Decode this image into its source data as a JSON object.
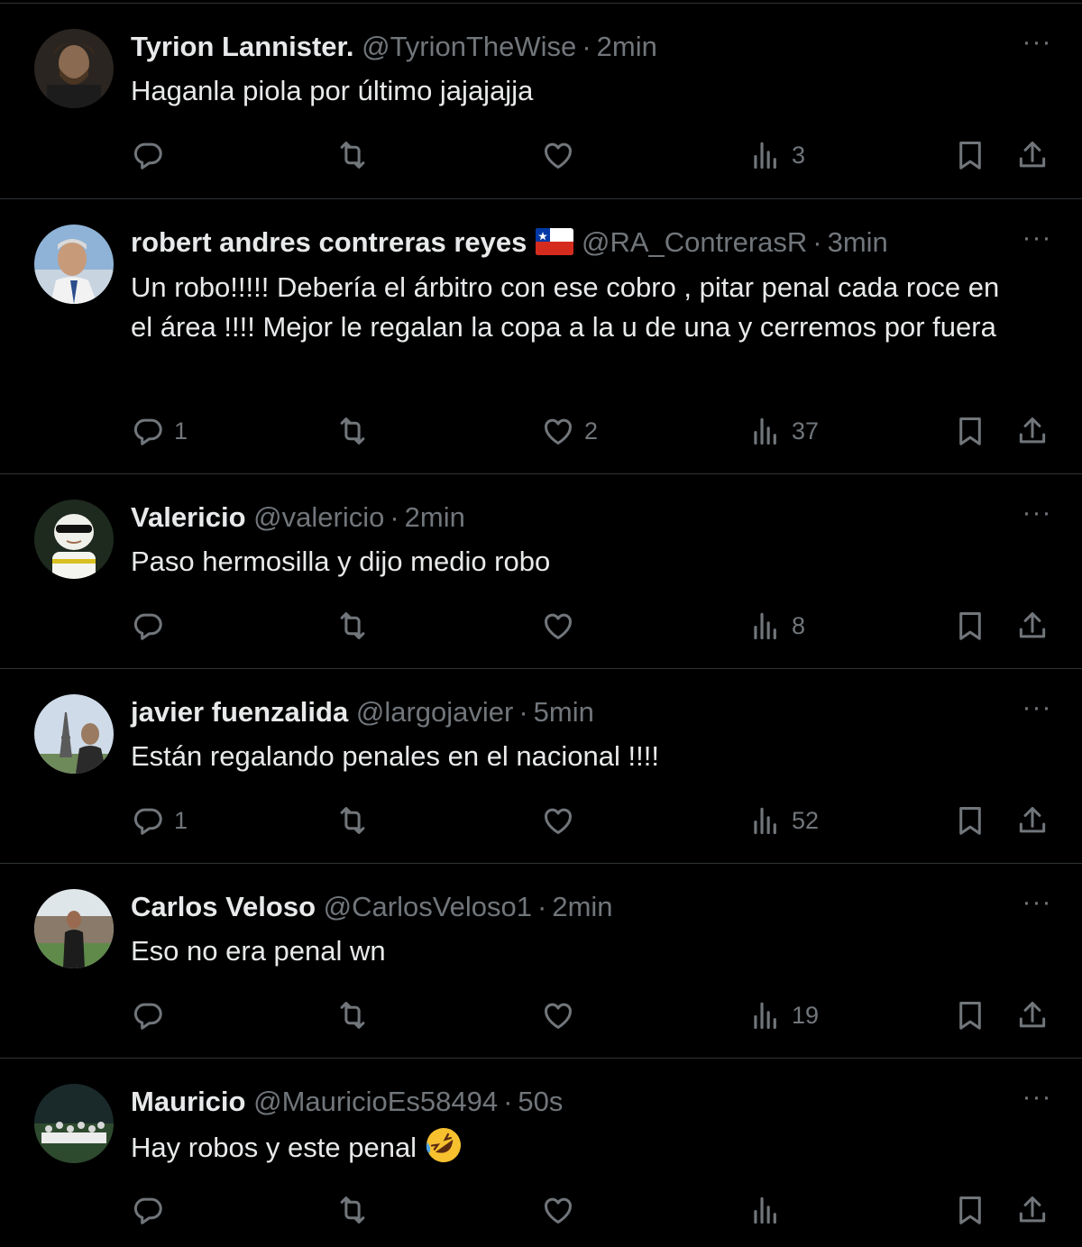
{
  "posts": [
    {
      "name": "Tyrion Lannister.",
      "handle": "@TyrionTheWise",
      "separator": "·",
      "time": "2min",
      "text": "Haganla piola por último jajajajja",
      "replies": "",
      "retweets": "",
      "likes": "",
      "views": "3"
    },
    {
      "name": "robert andres contreras reyes",
      "handle": "@RA_ContrerasR",
      "separator": "·",
      "time": "3min",
      "text": "Un robo!!!!! Debería el árbitro con ese cobro , pitar penal cada roce en el área !!!! Mejor le regalan la copa a la u de una y cerremos por fuera",
      "replies": "1",
      "retweets": "",
      "likes": "2",
      "views": "37"
    },
    {
      "name": "Valericio",
      "handle": "@valericio",
      "separator": "·",
      "time": "2min",
      "text": "Paso hermosilla y dijo medio robo",
      "replies": "",
      "retweets": "",
      "likes": "",
      "views": "8"
    },
    {
      "name": "javier fuenzalida",
      "handle": "@largojavier",
      "separator": "·",
      "time": "5min",
      "text": "Están regalando penales en el nacional !!!!",
      "replies": "1",
      "retweets": "",
      "likes": "",
      "views": "52"
    },
    {
      "name": "Carlos Veloso",
      "handle": "@CarlosVeloso1",
      "separator": "·",
      "time": "2min",
      "text": "Eso no era penal wn",
      "replies": "",
      "retweets": "",
      "likes": "",
      "views": "19"
    },
    {
      "name": "Mauricio",
      "handle": "@MauricioEs58494",
      "separator": "·",
      "time": "50s",
      "text": "Hay robos y este penal",
      "replies": "",
      "retweets": "",
      "likes": "",
      "views": ""
    }
  ],
  "icons": {
    "more": "ellipsis-icon",
    "reply": "reply-bubble-icon",
    "retweet": "retweet-icon",
    "like": "heart-icon",
    "views": "views-bar-chart-icon",
    "bookmark": "bookmark-icon",
    "share": "share-upload-icon",
    "emoji": "rolling-on-floor-laughing-emoji",
    "flag": "chile-flag-icon"
  },
  "colors": {
    "background": "#000000",
    "text": "#e7e9ea",
    "muted": "#71767b",
    "divider": "#2f3336"
  },
  "more_label": "···"
}
